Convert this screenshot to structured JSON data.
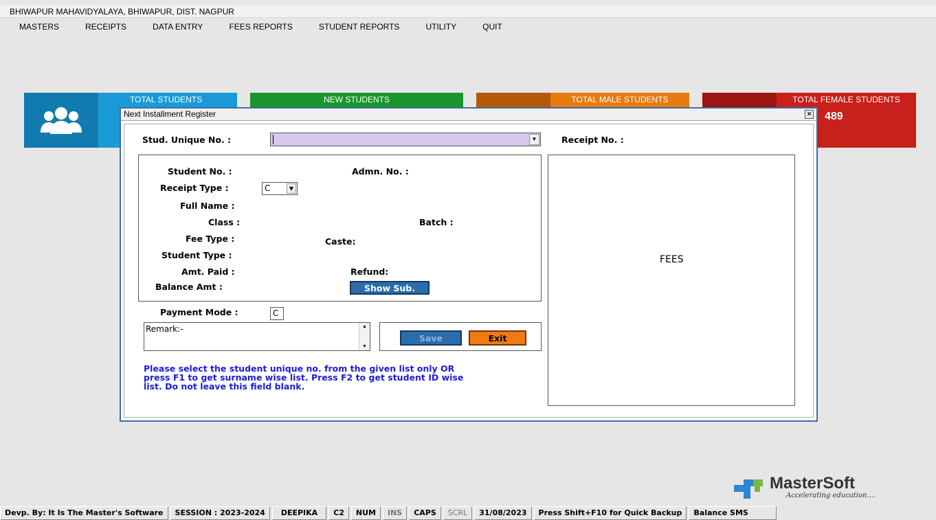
{
  "window": {
    "title": "BHIWAPUR MAHAVIDYALAYA, BHIWAPUR, DIST. NAGPUR"
  },
  "menu": [
    "MASTERS",
    "RECEIPTS",
    "DATA ENTRY",
    "FEES REPORTS",
    "STUDENT REPORTS",
    "UTILITY",
    "QUIT"
  ],
  "tiles": {
    "total_students": {
      "label": "TOTAL STUDENTS",
      "color": "#1a9ad6",
      "icon": "users-icon"
    },
    "new_students": {
      "label": "NEW STUDENTS",
      "color": "#0e7a22"
    },
    "male_students": {
      "label": "TOTAL MALE STUDENTS",
      "color": "#e87a12"
    },
    "female_students": {
      "label": "TOTAL FEMALE STUDENTS",
      "value": "489",
      "color": "#c8201a"
    }
  },
  "dialog": {
    "title": "Next Installment Register",
    "close": "×",
    "stud_unique_label": "Stud. Unique No.  :",
    "stud_unique_value": "",
    "receipt_no_label": "Receipt No. :",
    "student_no_label": "Student No.  :",
    "admn_no_label": "Admn. No. :",
    "receipt_type_label": "Receipt Type  :",
    "receipt_type_value": "C",
    "full_name_label": "Full Name :",
    "class_label": "Class :",
    "batch_label": "Batch :",
    "fee_type_label": "Fee Type :",
    "caste_label": "Caste:",
    "student_type_label": "Student Type :",
    "amt_paid_label": "Amt. Paid  :",
    "refund_label": "Refund:",
    "balance_amt_label": "Balance Amt  :",
    "show_sub_button": "Show Sub.",
    "payment_mode_label": "Payment Mode  :",
    "payment_mode_value": "C",
    "remark_value": "Remark:-",
    "save_button": "Save",
    "exit_button": "Exit",
    "fees_label": "FEES",
    "hint_text": [
      "Please select the student unique no. from the given list only OR",
      "press F1 to get surname wise list. Press F2 to get student ID wise",
      "list. Do not leave this field blank."
    ]
  },
  "logo": {
    "name": "MasterSoft",
    "tagline": "Accelerating education...."
  },
  "status": [
    "Devp. By: It Is The Master's Software",
    "SESSION : 2023-2024",
    "DEEPIKA",
    "C2",
    "NUM",
    "INS",
    "CAPS",
    "SCRL",
    "31/08/2023",
    "Press Shift+F10 for Quick Backup",
    "Balance SMS"
  ]
}
